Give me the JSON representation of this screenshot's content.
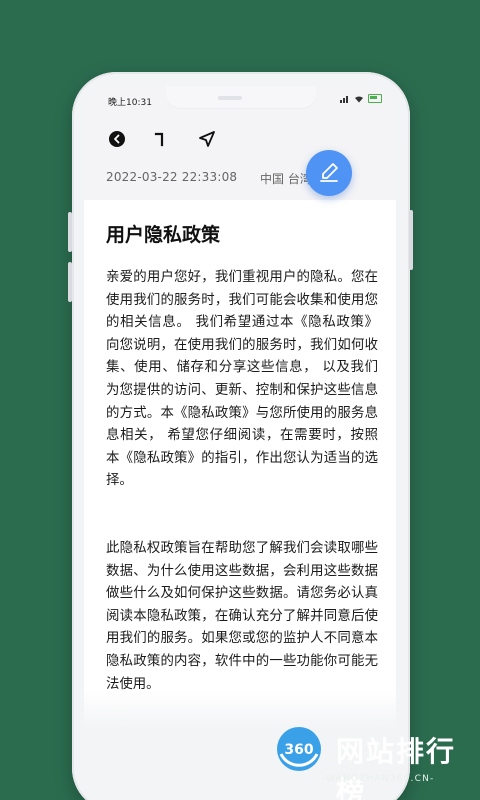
{
  "status_bar": {
    "time": "晚上10:31",
    "signal_icon": "signal-icon",
    "wifi_icon": "wifi-icon",
    "battery_icon": "battery-charging-icon"
  },
  "toolbar": {
    "back_icon": "back-icon",
    "bookmark_icon": "bookmark-icon",
    "share_icon": "navigation-arrow-icon"
  },
  "meta": {
    "datetime": "2022-03-22 22:33:08",
    "location": "中国 台湾"
  },
  "fab": {
    "icon": "edit-icon",
    "color": "#4f93f5"
  },
  "article": {
    "title": "用户隐私政策",
    "paragraphs": [
      "亲爱的用户您好，我们重视用户的隐私。您在使用我们的服务时，我们可能会收集和使用您的相关信息。 我们希望通过本《隐私政策》向您说明，在使用我们的服务时，我们如何收集、使用、储存和分享这些信息， 以及我们为您提供的访问、更新、控制和保护这些信息的方式。本《隐私政策》与您所使用的服务息息相关， 希望您仔细阅读，在需要时，按照本《隐私政策》的指引，作出您认为适当的选择。",
      "此隐私权政策旨在帮助您了解我们会读取哪些数据、为什么使用这些数据，会利用这些数据做些什么及如何保护这些数据。请您务必认真阅读本隐私政策，在确认充分了解并同意后使用我们的服务。如果您或您的监护人不同意本隐私政策的内容，软件中的一些功能你可能无法使用。"
    ]
  },
  "watermark": {
    "logo_text": "360",
    "brand": "网站排行榜",
    "url": "-WANGZHAN360.CN-"
  },
  "colors": {
    "background": "#2b6c4f",
    "accent": "#4f93f5"
  }
}
